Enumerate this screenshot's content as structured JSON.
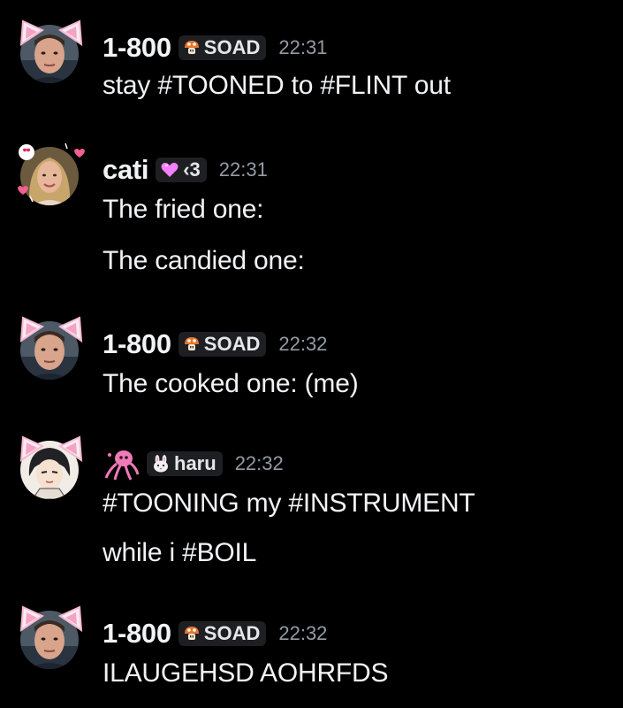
{
  "messages": [
    {
      "username": "1-800",
      "tag": "SOAD",
      "tag_icon": "mushroom-icon",
      "time": "22:31",
      "lines": [
        "stay #TOONED to #FLINT out"
      ]
    },
    {
      "username": "cati",
      "tag": "‹3",
      "tag_icon": "pink-heart-icon",
      "time": "22:31",
      "lines": [
        "The fried one:",
        "The candied one:"
      ]
    },
    {
      "username": "1-800",
      "tag": "SOAD",
      "tag_icon": "mushroom-icon",
      "time": "22:32",
      "lines": [
        "The cooked one: (me)"
      ]
    },
    {
      "username": "",
      "name_icon": "squid-icon",
      "tag": "haru",
      "tag_icon": "bunny-icon",
      "time": "22:32",
      "lines": [
        "#TOONING my #INSTRUMENT",
        "while i #BOIL"
      ]
    },
    {
      "username": "1-800",
      "tag": "SOAD",
      "tag_icon": "mushroom-icon",
      "time": "22:32",
      "lines": [
        "ILAUGEHSD AOHRFDS"
      ]
    }
  ],
  "colors": {
    "background": "#000000",
    "text": "#f2f3f5",
    "timestamp": "#949ba4",
    "tag_background": "#1e1f22",
    "accent_pink": "#f47fff"
  }
}
